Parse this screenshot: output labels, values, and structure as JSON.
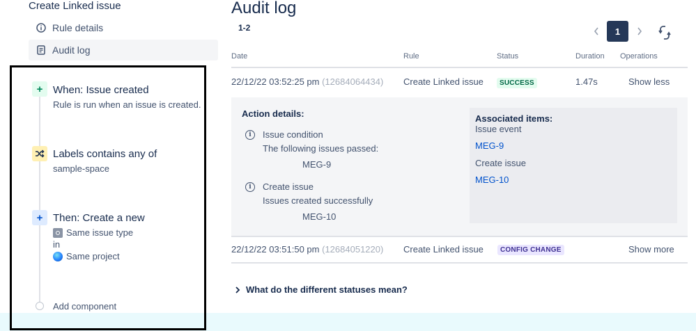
{
  "sidebar": {
    "rule_title": "Create Linked issue",
    "nav": [
      {
        "label": "Rule details",
        "icon": "info-icon"
      },
      {
        "label": "Audit log",
        "icon": "document-icon",
        "active": true
      }
    ],
    "steps": {
      "trigger": {
        "icon": "plus-icon",
        "title": "When: Issue created",
        "subtitle": "Rule is run when an issue is created."
      },
      "condition": {
        "icon": "shuffle-icon",
        "title": "Labels contains any of",
        "subtitle": "sample-space"
      },
      "action": {
        "icon": "plus-icon",
        "title": "Then: Create a new",
        "line1": "Same issue type",
        "line2": "in",
        "line3": "Same project"
      },
      "add": {
        "label": "Add component"
      }
    }
  },
  "main": {
    "title": "Audit log",
    "range": "1-2",
    "pagination": {
      "current": "1",
      "prev_icon": "chevron-left-icon",
      "next_icon": "chevron-right-icon",
      "refresh_icon": "refresh-icon"
    },
    "columns": [
      "Date",
      "Rule",
      "Status",
      "Duration",
      "Operations"
    ],
    "rows": [
      {
        "date": "22/12/22 03:52:25 pm",
        "id": "(12684064434)",
        "rule": "Create Linked issue",
        "status": "SUCCESS",
        "duration": "1.47s",
        "operation": "Show less"
      },
      {
        "date": "22/12/22 03:51:50 pm",
        "id": "(12684051220)",
        "rule": "Create Linked issue",
        "status": "CONFIG CHANGE",
        "duration": "",
        "operation": "Show more"
      }
    ],
    "details": {
      "heading": "Action details:",
      "items": [
        {
          "title": "Issue condition",
          "text": "The following issues passed:",
          "value": "MEG-9"
        },
        {
          "title": "Create issue",
          "text": "Issues created successfully",
          "value": "MEG-10"
        }
      ],
      "associated": {
        "heading": "Associated items:",
        "group1_label": "Issue event",
        "group1_link": "MEG-9",
        "group2_label": "Create issue",
        "group2_link": "MEG-10"
      }
    },
    "faq": "What do the different statuses mean?"
  },
  "colors": {
    "text": "#172b4d",
    "subtle": "#42526e",
    "link": "#0052cc",
    "success_bg": "#e3fcef",
    "success_text": "#006644",
    "config_bg": "#eae6ff",
    "config_text": "#403294",
    "pager_active": "#253858",
    "trigger_icon_bg": "#e3fcef",
    "condition_icon_bg": "#fff0b3",
    "action_icon_bg": "#deebff"
  }
}
